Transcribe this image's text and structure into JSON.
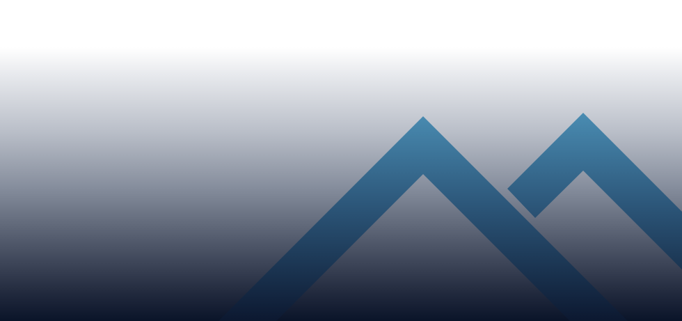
{
  "colors": {
    "background_top": "#ffffff",
    "background_bottom": "#0a1429",
    "chevron_top": "#4a8db3",
    "chevron_bottom": "#0c1830"
  }
}
